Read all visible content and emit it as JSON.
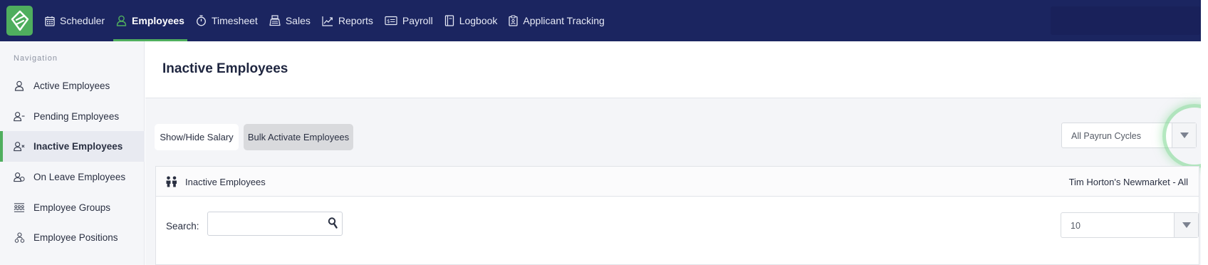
{
  "topnav": {
    "items": [
      {
        "label": "Scheduler",
        "icon": "calendar-icon"
      },
      {
        "label": "Employees",
        "icon": "person-icon",
        "active": true
      },
      {
        "label": "Timesheet",
        "icon": "stopwatch-icon"
      },
      {
        "label": "Sales",
        "icon": "register-icon"
      },
      {
        "label": "Reports",
        "icon": "chart-icon"
      },
      {
        "label": "Payroll",
        "icon": "money-icon"
      },
      {
        "label": "Logbook",
        "icon": "book-icon"
      },
      {
        "label": "Applicant Tracking",
        "icon": "clipboard-icon"
      }
    ]
  },
  "sidebar": {
    "heading": "Navigation",
    "items": [
      {
        "label": "Active Employees",
        "icon": "person-icon"
      },
      {
        "label": "Pending Employees",
        "icon": "person-pending-icon"
      },
      {
        "label": "Inactive Employees",
        "icon": "person-remove-icon",
        "active": true
      },
      {
        "label": "On Leave Employees",
        "icon": "person-leave-icon"
      },
      {
        "label": "Employee Groups",
        "icon": "group-icon"
      },
      {
        "label": "Employee Positions",
        "icon": "position-icon"
      }
    ]
  },
  "main": {
    "title": "Inactive Employees",
    "buttons": {
      "show_hide_salary": "Show/Hide Salary",
      "bulk_activate": "Bulk Activate Employees"
    },
    "payrun_select": {
      "value": "All Payrun Cycles"
    },
    "panel": {
      "title": "Inactive Employees",
      "location": "Tim Horton's Newmarket - All",
      "search_label": "Search:",
      "search_value": "",
      "page_length": "10"
    }
  },
  "colors": {
    "topbar": "#1b2560",
    "accent": "#4fae5e",
    "sidebar_bg": "#f5f6f9",
    "active_item_bg": "#e8eaf1"
  }
}
